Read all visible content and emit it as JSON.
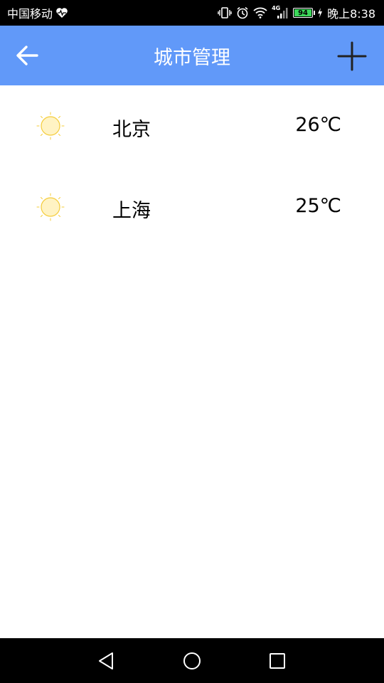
{
  "status_bar": {
    "carrier": "中国移动",
    "network": "4G",
    "battery": "94",
    "time": "晚上8:38"
  },
  "app_bar": {
    "title": "城市管理"
  },
  "cities": [
    {
      "name": "北京",
      "temperature": "26℃",
      "weather_icon": "sun-icon"
    },
    {
      "name": "上海",
      "temperature": "25℃",
      "weather_icon": "sun-icon"
    }
  ],
  "colors": {
    "app_bar": "#6199f9",
    "sun_fill": "#fff3c4",
    "sun_stroke": "#f4cc3a",
    "battery_green": "#3cd85a"
  }
}
